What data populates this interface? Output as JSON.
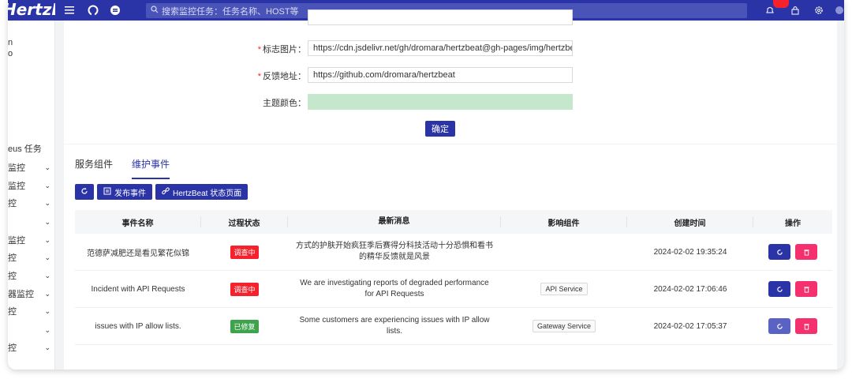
{
  "topbar": {
    "brand": "HertzBeat",
    "search_placeholder": "搜索监控任务：任务名称、HOST等"
  },
  "sidebar": {
    "items": [
      {
        "label": "n",
        "chevron": false
      },
      {
        "label": "o",
        "chevron": false
      },
      {
        "label": "eus 任务",
        "chevron": false
      },
      {
        "label": "监控",
        "chevron": true
      },
      {
        "label": "监控",
        "chevron": true
      },
      {
        "label": "控",
        "chevron": true
      },
      {
        "label": "",
        "chevron": true
      },
      {
        "label": "监控",
        "chevron": true
      },
      {
        "label": "控",
        "chevron": true
      },
      {
        "label": "控",
        "chevron": true
      },
      {
        "label": "器监控",
        "chevron": true
      },
      {
        "label": "控",
        "chevron": true
      },
      {
        "label": "",
        "chevron": true
      },
      {
        "label": "控",
        "chevron": true
      }
    ]
  },
  "settings": {
    "fields": [
      {
        "label": "标志图片：",
        "required": true,
        "value": "https://cdn.jsdelivr.net/gh/dromara/hertzbeat@gh-pages/img/hertzbeat-brand.svg"
      },
      {
        "label": "反馈地址：",
        "required": true,
        "value": "https://github.com/dromara/hertzbeat"
      },
      {
        "label": "主题颜色：",
        "required": false,
        "value": ""
      }
    ],
    "confirm_label": "确定"
  },
  "status": {
    "tabs": [
      {
        "label": "服务组件",
        "active": false
      },
      {
        "label": "维护事件",
        "active": true
      }
    ],
    "actions": {
      "publish_label": "发布事件",
      "status_page_label": "HertzBeat 状态页面"
    },
    "table": {
      "headers": [
        "事件名称",
        "过程状态",
        "最新消息",
        "影响组件",
        "创建时间",
        "操作"
      ],
      "rows": [
        {
          "name": "范德萨减肥还是看见繁花似锦",
          "state": "调查中",
          "state_color": "#f5222d",
          "message": "方式的护肤开始疯狂季后赛得分科技活动十分恐惧和看书的精华反馈就是风景",
          "component": "",
          "created": "2024-02-02 19:35:24",
          "refresh_light": false
        },
        {
          "name": "Incident with API Requests",
          "state": "调查中",
          "state_color": "#f5222d",
          "message": "We are investigating reports of degraded performance for API Requests",
          "component": "API Service",
          "created": "2024-02-02 17:06:46",
          "refresh_light": false
        },
        {
          "name": "issues with IP allow lists.",
          "state": "已修复",
          "state_color": "#3fa34d",
          "message": "Some customers are experiencing issues with IP allow lists.",
          "component": "Gateway Service",
          "created": "2024-02-02 17:05:37",
          "refresh_light": true
        }
      ]
    }
  },
  "colors": {
    "primary": "#2b34a6",
    "danger": "#f5306e",
    "theme_swatch": "#c5e8cc"
  }
}
